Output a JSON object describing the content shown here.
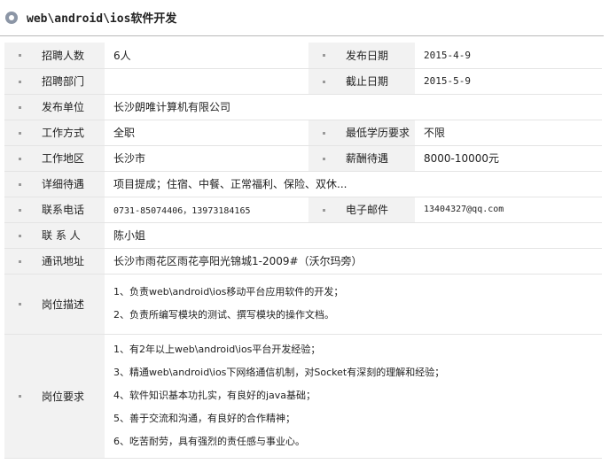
{
  "header": {
    "title": "web\\android\\ios软件开发"
  },
  "rows": {
    "recruit_count": {
      "label": "招聘人数",
      "value": "6人"
    },
    "publish_date": {
      "label": "发布日期",
      "value": "2015-4-9"
    },
    "department": {
      "label": "招聘部门",
      "value": ""
    },
    "deadline": {
      "label": "截止日期",
      "value": "2015-5-9"
    },
    "company": {
      "label": "发布单位",
      "value": "长沙朗唯计算机有限公司"
    },
    "work_mode": {
      "label": "工作方式",
      "value": "全职"
    },
    "education": {
      "label": "最低学历要求",
      "value": "不限"
    },
    "location": {
      "label": "工作地区",
      "value": "长沙市"
    },
    "salary": {
      "label": "薪酬待遇",
      "value": "8000-10000元"
    },
    "benefits": {
      "label": "详细待遇",
      "value": "项目提成；住宿、中餐、正常福利、保险、双休..."
    },
    "phone": {
      "label": "联系电话",
      "value": "0731-85074406，13973184165"
    },
    "email": {
      "label": "电子邮件",
      "value": "13404327@qq.com"
    },
    "contact": {
      "label": "联 系 人",
      "value": "陈小姐"
    },
    "address": {
      "label": "通讯地址",
      "value": "长沙市雨花区雨花亭阳光锦城1-2009#（沃尔玛旁）"
    },
    "job_description": {
      "label": "岗位描述",
      "lines": [
        "1、负责web\\android\\ios移动平台应用软件的开发；",
        "2、负责所编写模块的测试、撰写模块的操作文档。"
      ]
    },
    "job_requirements": {
      "label": "岗位要求",
      "lines": [
        "1、有2年以上web\\android\\ios平台开发经验；",
        "3、精通web\\android\\ios下网络通信机制，对Socket有深刻的理解和经验；",
        "4、软件知识基本功扎实，有良好的java基础；",
        "5、善于交流和沟通，有良好的合作精神；",
        "6、吃苦耐劳，具有强烈的责任感与事业心。"
      ]
    }
  }
}
